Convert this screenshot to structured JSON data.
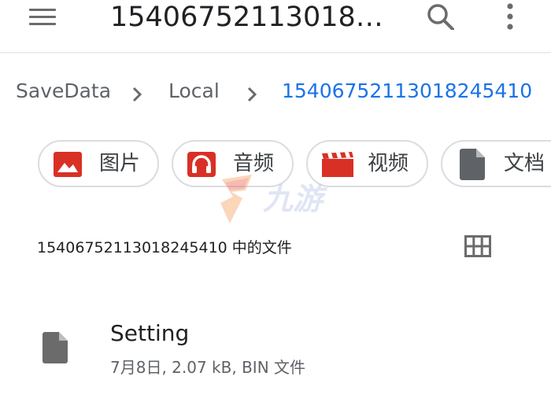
{
  "appbar": {
    "title": "15406752113018…",
    "menu_icon": "menu-icon",
    "search_icon": "search-icon",
    "more_icon": "more-vertical-icon"
  },
  "breadcrumb": {
    "items": [
      "SaveData",
      "Local",
      "15406752113018245410"
    ],
    "separator_icon": "chevron-right-icon",
    "active_color": "#1a73e8"
  },
  "categories": [
    {
      "label": "图片",
      "icon": "image-icon",
      "color": "#d93025"
    },
    {
      "label": "音频",
      "icon": "audio-icon",
      "color": "#d93025"
    },
    {
      "label": "视频",
      "icon": "video-icon",
      "color": "#d93025"
    },
    {
      "label": "文档",
      "icon": "document-icon",
      "color": "#5f6368"
    }
  ],
  "watermark": {
    "text": "九游",
    "icon": "watermark-logo"
  },
  "section": {
    "title": "15406752113018245410 中的文件",
    "view_toggle_icon": "grid-view-icon"
  },
  "files": [
    {
      "name": "Setting",
      "meta": "7月8日, 2.07 kB, BIN 文件",
      "icon": "file-icon"
    }
  ]
}
